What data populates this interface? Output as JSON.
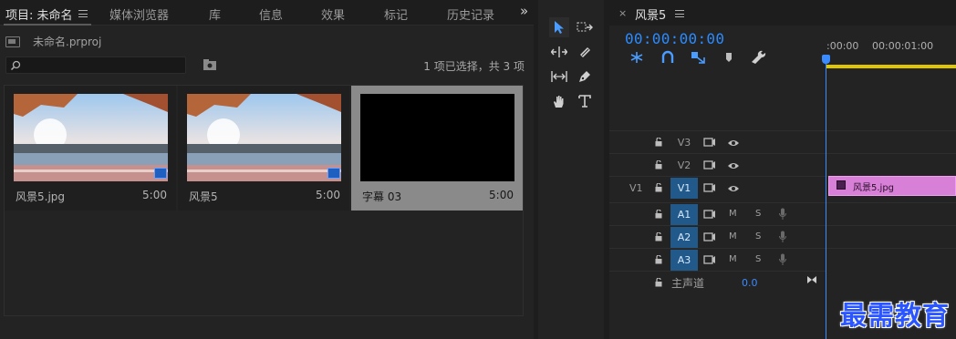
{
  "project": {
    "tabs": [
      {
        "label": "项目: 未命名"
      },
      {
        "label": "媒体浏览器"
      },
      {
        "label": "库"
      },
      {
        "label": "信息"
      },
      {
        "label": "效果"
      },
      {
        "label": "标记"
      },
      {
        "label": "历史记录"
      }
    ],
    "overflow_label": "»",
    "file_name": "未命名.prproj",
    "search": {
      "value": "",
      "placeholder": ""
    },
    "selection_status": "1 项已选择，共 3 项",
    "clips": [
      {
        "name": "风景5.jpg",
        "duration": "5:00",
        "type": "image",
        "selected": false
      },
      {
        "name": "风景5",
        "duration": "5:00",
        "type": "sequence",
        "selected": false
      },
      {
        "name": "字幕 03",
        "duration": "5:00",
        "type": "title",
        "selected": true
      }
    ]
  },
  "tools": [
    {
      "icon": "selection-arrow-icon",
      "active": true
    },
    {
      "icon": "track-select-icon",
      "active": false
    },
    {
      "icon": "ripple-edit-icon",
      "active": false
    },
    {
      "icon": "razor-icon",
      "active": false
    },
    {
      "icon": "slip-icon",
      "active": false
    },
    {
      "icon": "pen-icon",
      "active": false
    },
    {
      "icon": "hand-icon",
      "active": false
    },
    {
      "icon": "type-icon",
      "active": false
    }
  ],
  "timeline": {
    "close_label": "×",
    "title": "风景5",
    "timecode": "00:00:00:00",
    "ruler_labels": [
      ":00:00",
      "00:00:01:00"
    ],
    "tracks": {
      "video": [
        {
          "label": "V3",
          "on": false
        },
        {
          "label": "V2",
          "on": false
        },
        {
          "label": "V1",
          "on": true,
          "source": "V1"
        }
      ],
      "audio": [
        {
          "label": "A1",
          "m": "M",
          "s": "S"
        },
        {
          "label": "A2",
          "m": "M",
          "s": "S"
        },
        {
          "label": "A3",
          "m": "M",
          "s": "S"
        }
      ]
    },
    "clip_on_v1": "风景5.jpg",
    "master": {
      "label": "主声道",
      "value": "0.0"
    }
  },
  "watermark": "最需教育",
  "colors": {
    "accent_blue": "#2b8bff",
    "track_on": "#215a8a",
    "clip_pink": "#d87fd8",
    "ruler_yellow": "#e0c800"
  }
}
